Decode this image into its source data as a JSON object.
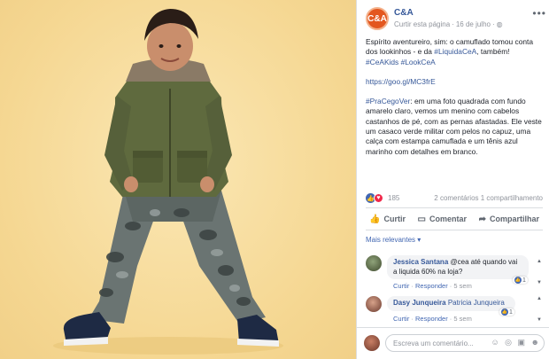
{
  "page": {
    "name": "C&A",
    "logo_text": "C&A"
  },
  "meta": {
    "follow_label": "Curtir esta página",
    "date": "16 de julho",
    "privacy_icon": "globe-icon"
  },
  "more_label": "•••",
  "post": {
    "p1_text": "Espírito aventureiro, sim: o camuflado tomou conta dos lookinhos - e da ",
    "p1_tag1": "#LiquidaCeA",
    "p1_mid": ", também! ",
    "p1_tag2": "#CeAKids",
    "p1_tag3": "#LookCeA",
    "link": "https://goo.gl/MC3frE",
    "p3_tag": "#PraCegoVer",
    "p3_text": ": em uma foto quadrada com fundo amarelo claro, vemos um menino com cabelos castanhos de pé, com as pernas afastadas. Ele veste um casaco verde militar com pelos no capuz, uma calça com estampa camuflada e um tênis azul marinho com detalhes em branco."
  },
  "stats": {
    "reactions_count": "185",
    "comments_shares": "2 comentários  1 compartilhamento"
  },
  "actions": {
    "like": "Curtir",
    "comment": "Comentar",
    "share": "Compartilhar"
  },
  "relevant_label": "Mais relevantes ▾",
  "comments": [
    {
      "name": "Jessica Santana",
      "text": "@cea até quando vai a liquida 60% na loja?",
      "likes": "1",
      "reply_like": "Curtir",
      "reply": "Responder",
      "time": "5 sem"
    },
    {
      "name": "Dasy Junqueira",
      "tag": "Patricia Junqueira",
      "likes": "1",
      "reply_like": "Curtir",
      "reply": "Responder",
      "time": "5 sem"
    }
  ],
  "composer": {
    "placeholder": "Escreva um comentário...",
    "icons": "☺ ◎ ▣ ☻"
  },
  "colors": {
    "brand": "#e3571f",
    "link": "#365899",
    "like_blue": "#4267b2",
    "background": "#f5d792"
  }
}
